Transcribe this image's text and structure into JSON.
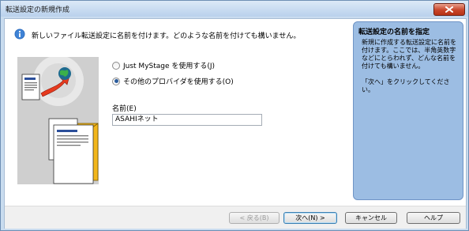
{
  "window": {
    "title": "転送設定の新規作成"
  },
  "header": {
    "text": "新しいファイル転送設定に名前を付けます。どのような名前を付けても構いません。"
  },
  "options": [
    {
      "label": "Just MyStage を使用する(J)",
      "checked": false
    },
    {
      "label": "その他のプロバイダを使用する(O)",
      "checked": true
    }
  ],
  "name_field": {
    "label": "名前(E)",
    "value": "ASAHIネット"
  },
  "help": {
    "title": "転送設定の名前を指定",
    "body": "新規に作成する転送設定に名前を付けます。ここでは、半角英数字などにとらわれず、どんな名前を付けても構いません。",
    "next_hint": "「次へ」をクリックしてください。"
  },
  "buttons": {
    "back": "< 戻る(B)",
    "next": "次へ(N) >",
    "cancel": "キャンセル",
    "help": "ヘルプ"
  },
  "colors": {
    "accent": "#9cbde3",
    "title_bar": "#c9dcef",
    "close": "#c8452a"
  }
}
